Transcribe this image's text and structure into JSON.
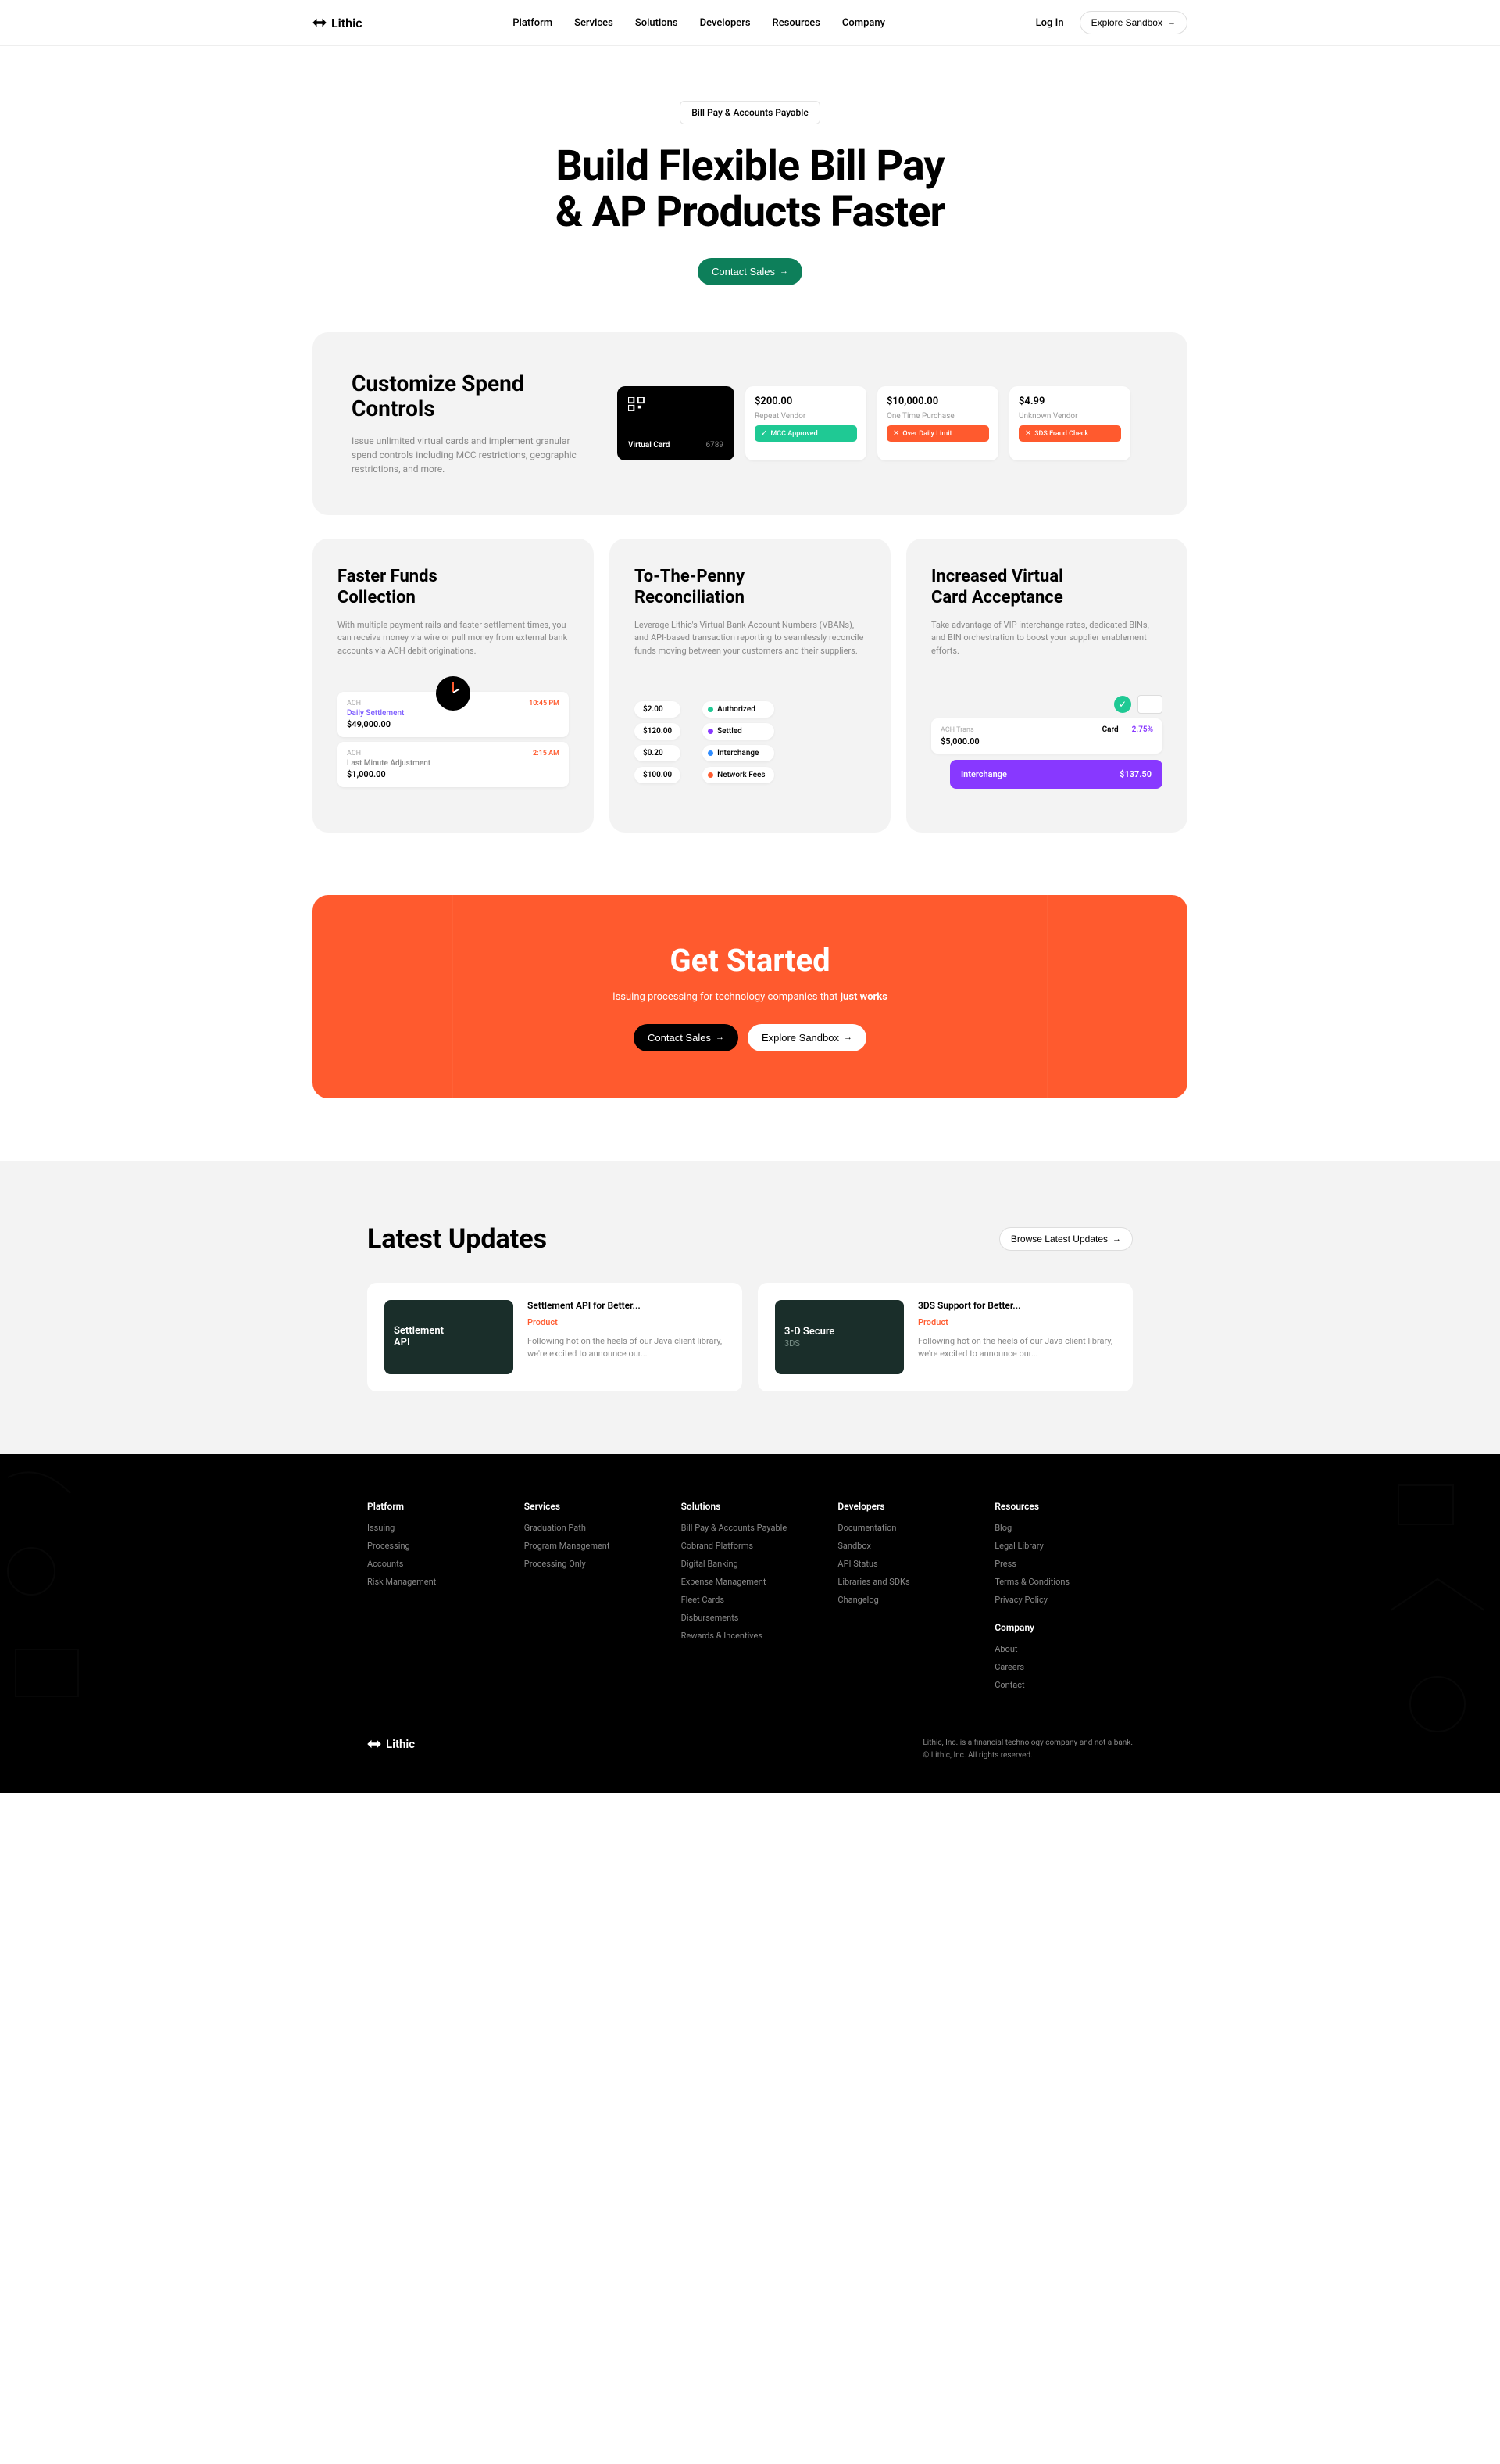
{
  "brand": "Lithic",
  "nav": {
    "items": [
      "Platform",
      "Services",
      "Solutions",
      "Developers",
      "Resources",
      "Company"
    ],
    "login": "Log In",
    "explore": "Explore Sandbox"
  },
  "hero": {
    "badge": "Bill Pay & Accounts Payable",
    "title_l1": "Build Flexible Bill Pay",
    "title_l2": "& AP Products Faster",
    "cta": "Contact Sales"
  },
  "feature_hero": {
    "title_l1": "Customize Spend",
    "title_l2": "Controls",
    "desc": "Issue unlimited virtual cards and implement granular spend controls including MCC restrictions, geographic restrictions, and more.",
    "virtual_card": {
      "label": "Virtual Card",
      "last4": "6789"
    },
    "txns": [
      {
        "amount": "$200.00",
        "vendor": "Repeat Vendor",
        "status": "MCC Approved",
        "status_type": "green"
      },
      {
        "amount": "$10,000.00",
        "vendor": "One Time Purchase",
        "status": "Over Daily Limit",
        "status_type": "orange"
      },
      {
        "amount": "$4.99",
        "vendor": "Unknown Vendor",
        "status": "3DS Fraud Check",
        "status_type": "orange"
      }
    ]
  },
  "three_col": [
    {
      "title_l1": "Faster Funds",
      "title_l2": "Collection",
      "desc": "With multiple payment rails and faster settlement times, you can receive money via wire or pull money from external bank accounts via ACH debit originations.",
      "settlements": [
        {
          "label": "ACH",
          "time": "10:45 PM",
          "name": "Daily Settlement",
          "amt": "$49,000.00"
        },
        {
          "label": "ACH",
          "time": "2:15 AM",
          "name": "Last Minute Adjustment",
          "amt": "$1,000.00"
        }
      ]
    },
    {
      "title_l1": "To-The-Penny",
      "title_l2": "Reconciliation",
      "desc": "Leverage Lithic's Virtual Bank Account Numbers (VBANs), and API-based transaction reporting to seamlessly reconcile funds moving between your customers and their suppliers.",
      "flow_left": [
        "$2.00",
        "$120.00",
        "$0.20",
        "$100.00"
      ],
      "flow_right": [
        "Authorized",
        "Settled",
        "Interchange",
        "Network Fees"
      ]
    },
    {
      "title_l1": "Increased Virtual",
      "title_l2": "Card Acceptance",
      "desc": "Take advantage of VIP interchange rates, dedicated BINs, and BIN orchestration to boost your supplier enablement efforts.",
      "inter": {
        "label": "ACH Trans",
        "card_label": "Card",
        "pct": "2.75%",
        "amt": "$5,000.00",
        "purple_label": "Interchange",
        "purple_amt": "$137.50"
      }
    }
  ],
  "cta": {
    "title": "Get Started",
    "text_prefix": "Issuing processing for technology companies that ",
    "text_bold": "just works",
    "btn1": "Contact Sales",
    "btn2": "Explore Sandbox"
  },
  "updates": {
    "title": "Latest Updates",
    "browse": "Browse Latest Updates",
    "items": [
      {
        "thumb_l1": "Settlement",
        "thumb_l2": "API",
        "title": "Settlement API for Better...",
        "tag": "Product",
        "desc": "Following hot on the heels of our Java client library, we're excited to announce our..."
      },
      {
        "thumb_l1": "3-D Secure",
        "thumb_l2": "3DS",
        "title": "3DS Support for Better...",
        "tag": "Product",
        "desc": "Following hot on the heels of our Java client library, we're excited to announce our..."
      }
    ]
  },
  "footer": {
    "cols": [
      {
        "title": "Platform",
        "links": [
          "Issuing",
          "Processing",
          "Accounts",
          "Risk Management"
        ]
      },
      {
        "title": "Services",
        "links": [
          "Graduation Path",
          "Program Management",
          "Processing Only"
        ]
      },
      {
        "title": "Solutions",
        "links": [
          "Bill Pay & Accounts Payable",
          "Cobrand Platforms",
          "Digital Banking",
          "Expense Management",
          "Fleet Cards",
          "Disbursements",
          "Rewards & Incentives"
        ]
      },
      {
        "title": "Developers",
        "links": [
          "Documentation",
          "Sandbox",
          "API Status",
          "Libraries and SDKs",
          "Changelog"
        ]
      },
      {
        "title": "Resources",
        "links": [
          "Blog",
          "Legal Library",
          "Press",
          "Terms & Conditions",
          "Privacy Policy"
        ],
        "sub_title": "Company",
        "sub_links": [
          "About",
          "Careers",
          "Contact"
        ]
      }
    ],
    "legal_l1": "Lithic, Inc. is a financial technology company and not a bank.",
    "legal_l2": "© Lithic, Inc. All rights reserved."
  }
}
